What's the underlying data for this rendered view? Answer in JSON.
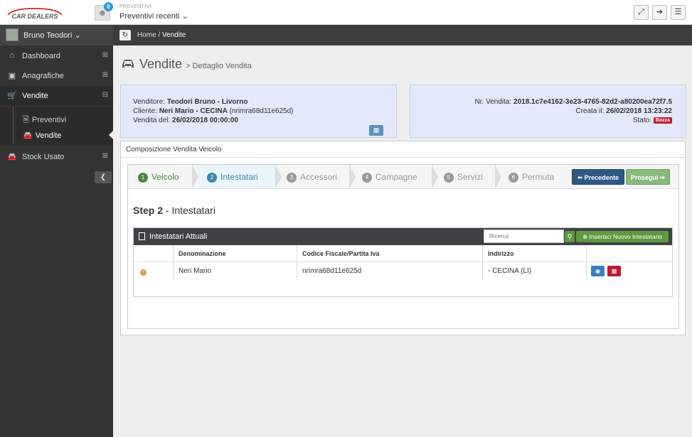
{
  "topbar": {
    "logo_text": "CAR DEALERS",
    "notifications_count": "0",
    "preventivi_label": "PREVENTIVI:",
    "preventivi_value": "Preventivi recenti"
  },
  "user": {
    "name": "Bruno Teodori"
  },
  "sidebar": {
    "items": [
      {
        "label": "Dashboard",
        "icon": "home-icon"
      },
      {
        "label": "Anagrafiche",
        "icon": "address-card-icon"
      },
      {
        "label": "Vendite",
        "icon": "cart-icon"
      },
      {
        "label": "Stock Usato",
        "icon": "car-icon"
      }
    ],
    "sub_items": [
      {
        "label": "Preventivi",
        "icon": "file-icon"
      },
      {
        "label": "Vendite",
        "icon": "car-icon"
      }
    ]
  },
  "breadcrumb": {
    "home": "Home",
    "separator": "/",
    "current": "Vendite"
  },
  "page": {
    "title": "Vendite",
    "subtitle": "> Dettaglio Vendita"
  },
  "info_left": {
    "venditore_label": "Venditore:",
    "venditore_value": "Teodori Bruno - Livorno",
    "cliente_label": "Cliente:",
    "cliente_value": "Neri Mario - CECINA",
    "cliente_code": "(nrimra68d11e625d)",
    "vendita_label": "Vendita del:",
    "vendita_value": "26/02/2018 00:00:00"
  },
  "info_right": {
    "nr_label": "Nr. Vendita:",
    "nr_value": "2018.1c7e4162-3e23-4765-82d2-a80200ea72f7.5",
    "creata_label": "Creata il:",
    "creata_value": "26/02/2018 13:23:22",
    "stato_label": "Stato:",
    "stato_value": "Bozza"
  },
  "panel": {
    "heading": "Composizione Vendita Veicolo"
  },
  "wizard": {
    "steps": [
      {
        "num": "1",
        "label": "Veicolo"
      },
      {
        "num": "2",
        "label": "Intestatari"
      },
      {
        "num": "3",
        "label": "Accessori"
      },
      {
        "num": "4",
        "label": "Campagne"
      },
      {
        "num": "5",
        "label": "Servizi"
      },
      {
        "num": "6",
        "label": "Permuta"
      }
    ],
    "prev_label": "Precedente",
    "next_label": "Prosegui"
  },
  "step": {
    "prefix": "Step 2",
    "name": "- Intestatari"
  },
  "table": {
    "title": "Intestatari Attuali",
    "search_placeholder": "Ricerca",
    "insert_label": "Inserisci Nuovo Intestatario",
    "columns": [
      "Denominazione",
      "Codice Fiscale/Partita Iva",
      "Indirizzo"
    ],
    "rows": [
      {
        "name": "Neri Mario",
        "cf": "nrimra68d11e625d",
        "address": "- CECINA (LI)"
      }
    ]
  },
  "colors": {
    "sidebar_bg": "#333333",
    "info_bg": "#e4e8fb",
    "primary": "#2c5a85",
    "success": "#5b9a3d",
    "danger": "#c0192e"
  }
}
